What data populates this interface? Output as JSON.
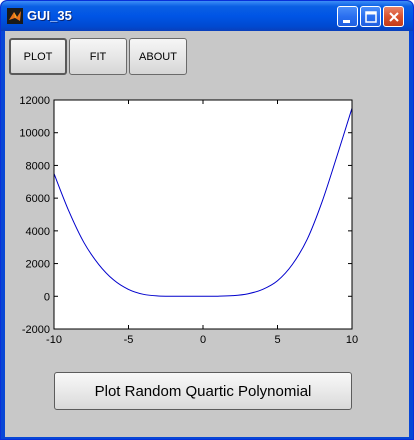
{
  "window": {
    "title": "GUI_35",
    "icon": "matlab-logo-icon",
    "controls": [
      "minimize-icon",
      "maximize-icon",
      "close-icon"
    ]
  },
  "toolbar": {
    "buttons": [
      {
        "label": "PLOT"
      },
      {
        "label": "FIT"
      },
      {
        "label": "ABOUT"
      }
    ]
  },
  "chart_data": {
    "type": "line",
    "title": "",
    "xlabel": "",
    "ylabel": "",
    "xlim": [
      -10,
      10
    ],
    "ylim": [
      -2000,
      12000
    ],
    "x_ticks": [
      -10,
      -5,
      0,
      5,
      10
    ],
    "x_tick_labels": [
      "-10",
      "-5",
      "0",
      "5",
      "10"
    ],
    "y_ticks": [
      -2000,
      0,
      2000,
      4000,
      6000,
      8000,
      10000,
      12000
    ],
    "y_tick_labels": [
      "-2000",
      "0",
      "2000",
      "4000",
      "6000",
      "8000",
      "10000",
      "12000"
    ],
    "grid": false,
    "series": [
      {
        "color": "#0000cc",
        "x": [
          -10,
          -9,
          -8,
          -7,
          -6,
          -5,
          -4,
          -3,
          -2,
          -1,
          0,
          1,
          2,
          3,
          4,
          5,
          6,
          7,
          8,
          9,
          10
        ],
        "y": [
          7500,
          5200,
          3300,
          1950,
          1000,
          420,
          120,
          20,
          5,
          2,
          0,
          5,
          40,
          150,
          420,
          950,
          1950,
          3500,
          5800,
          8600,
          11500
        ]
      }
    ]
  },
  "action_button": {
    "label": "Plot Random Quartic Polynomial"
  },
  "colors": {
    "title_bar": "#0055e5",
    "client_bg": "#c8c8c8",
    "plot_line": "#0000cc"
  }
}
